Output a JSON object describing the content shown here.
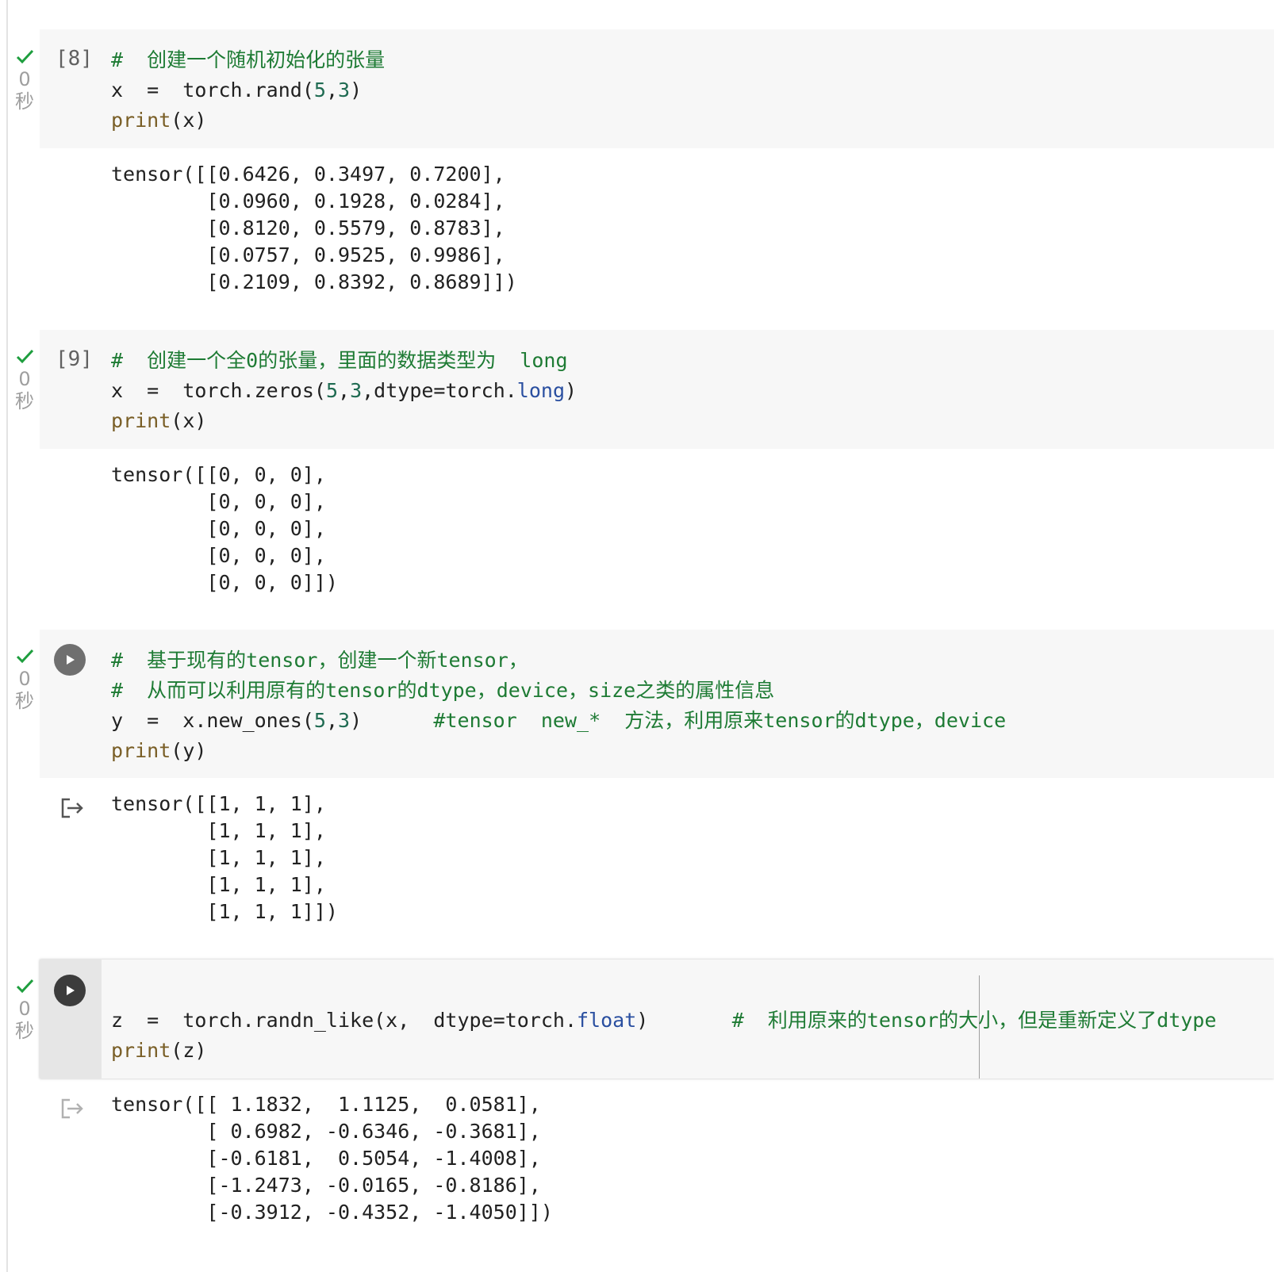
{
  "cells": [
    {
      "exec_label": "[8]",
      "status": {
        "secs": "0",
        "unit": "秒"
      },
      "code_lines": [
        [
          {
            "t": "#  创建一个随机初始化的张量",
            "c": "comment"
          }
        ],
        [
          {
            "t": "x  =  torch.rand(",
            "c": ""
          },
          {
            "t": "5",
            "c": "num"
          },
          {
            "t": ",",
            "c": ""
          },
          {
            "t": "3",
            "c": "num"
          },
          {
            "t": ")",
            "c": ""
          }
        ],
        [
          {
            "t": "print",
            "c": "kw"
          },
          {
            "t": "(x)",
            "c": ""
          }
        ]
      ],
      "output_lines": [
        "tensor([[0.6426, 0.3497, 0.7200],",
        "        [0.0960, 0.1928, 0.0284],",
        "        [0.8120, 0.5579, 0.8783],",
        "        [0.0757, 0.9525, 0.9986],",
        "        [0.2109, 0.8392, 0.8689]])"
      ]
    },
    {
      "exec_label": "[9]",
      "status": {
        "secs": "0",
        "unit": "秒"
      },
      "code_lines": [
        [
          {
            "t": "#  创建一个全0的张量，里面的数据类型为  long",
            "c": "comment"
          }
        ],
        [
          {
            "t": "x  =  torch.zeros(",
            "c": ""
          },
          {
            "t": "5",
            "c": "num"
          },
          {
            "t": ",",
            "c": ""
          },
          {
            "t": "3",
            "c": "num"
          },
          {
            "t": ",dtype=torch.",
            "c": ""
          },
          {
            "t": "long",
            "c": "attr"
          },
          {
            "t": ")",
            "c": ""
          }
        ],
        [
          {
            "t": "print",
            "c": "kw"
          },
          {
            "t": "(x)",
            "c": ""
          }
        ]
      ],
      "output_lines": [
        "tensor([[0, 0, 0],",
        "        [0, 0, 0],",
        "        [0, 0, 0],",
        "        [0, 0, 0],",
        "        [0, 0, 0]])"
      ]
    },
    {
      "exec_label": "",
      "status": {
        "secs": "0",
        "unit": "秒"
      },
      "code_lines": [
        [
          {
            "t": "#  基于现有的tensor，创建一个新tensor，",
            "c": "comment"
          }
        ],
        [
          {
            "t": "#  从而可以利用原有的tensor的dtype，device，size之类的属性信息",
            "c": "comment"
          }
        ],
        [
          {
            "t": "y  =  x.new_ones(",
            "c": ""
          },
          {
            "t": "5",
            "c": "num"
          },
          {
            "t": ",",
            "c": ""
          },
          {
            "t": "3",
            "c": "num"
          },
          {
            "t": ")      ",
            "c": ""
          },
          {
            "t": "#tensor  new_*  方法，利用原来tensor的dtype，device",
            "c": "comment"
          }
        ],
        [
          {
            "t": "print",
            "c": "kw"
          },
          {
            "t": "(y)",
            "c": ""
          }
        ]
      ],
      "output_lines": [
        "tensor([[1, 1, 1],",
        "        [1, 1, 1],",
        "        [1, 1, 1],",
        "        [1, 1, 1],",
        "        [1, 1, 1]])"
      ]
    },
    {
      "exec_label": "",
      "status": {
        "secs": "0",
        "unit": "秒"
      },
      "code_lines": [
        [
          {
            "t": "",
            "c": ""
          }
        ],
        [
          {
            "t": "z  =  torch.randn_like(x,  dtype=torch.",
            "c": ""
          },
          {
            "t": "float",
            "c": "attr"
          },
          {
            "t": ")       ",
            "c": ""
          },
          {
            "t": "#  利用原来的tensor的大小，但是重新定义了dtype",
            "c": "comment"
          }
        ],
        [
          {
            "t": "print",
            "c": "kw"
          },
          {
            "t": "(z)",
            "c": ""
          }
        ]
      ],
      "output_lines": [
        "tensor([[ 1.1832,  1.1125,  0.0581],",
        "        [ 0.6982, -0.6346, -0.3681],",
        "        [-0.6181,  0.5054, -1.4008],",
        "        [-1.2473, -0.0165, -0.8186],",
        "        [-0.3912, -0.4352, -1.4050]])"
      ]
    }
  ],
  "icons": {
    "check": "check-icon",
    "run": "play-icon",
    "output": "output-redirect-icon"
  },
  "colors": {
    "check": "#1e9e3e",
    "comment": "#1e7b34",
    "number": "#1f6b52",
    "keyword": "#795e26",
    "attribute": "#2a4fa0",
    "code_bg": "#f7f7f7"
  }
}
